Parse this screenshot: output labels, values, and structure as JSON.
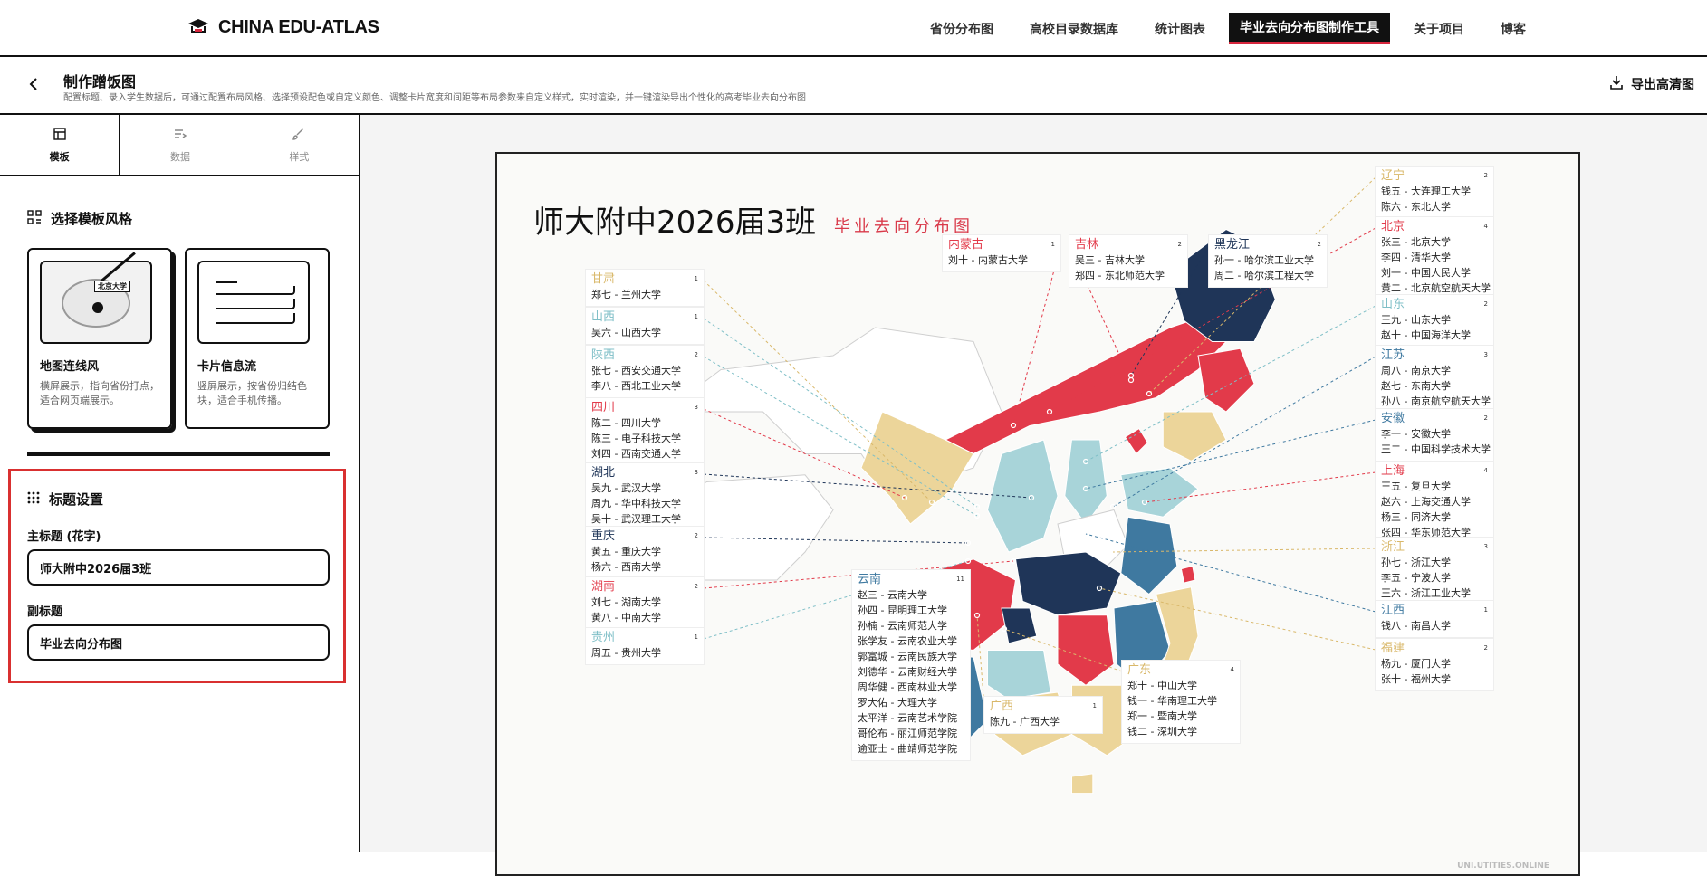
{
  "nav": {
    "logo_text": "CHINA EDU-ATLAS",
    "links": [
      "省份分布图",
      "高校目录数据库",
      "统计图表",
      "毕业去向分布图制作工具",
      "关于项目",
      "博客"
    ]
  },
  "header": {
    "title": "制作蹭饭图",
    "description": "配置标题、录入学生数据后，可通过配置布局风格、选择预设配色或自定义颜色、调整卡片宽度和间距等布局参数来自定义样式，实时渲染，并一键渲染导出个性化的高考毕业去向分布图",
    "export_label": "导出高清图"
  },
  "tabs": [
    {
      "label": "模板",
      "icon": "layout-icon"
    },
    {
      "label": "数据",
      "icon": "list-icon"
    },
    {
      "label": "样式",
      "icon": "brush-icon"
    }
  ],
  "template_section": {
    "title": "选择模板风格",
    "cards": [
      {
        "name": "地图连线风",
        "desc": "横屏展示，指向省份打点，适合网页端展示。",
        "thumb_label": "北京大学"
      },
      {
        "name": "卡片信息流",
        "desc": "竖屏展示，按省份归结色块，适合手机传播。"
      }
    ]
  },
  "title_section": {
    "title": "标题设置",
    "main_label": "主标题 (花字)",
    "main_value": "师大附中2026届3班",
    "sub_label": "副标题",
    "sub_value": "毕业去向分布图"
  },
  "poster": {
    "title": "师大附中2026届3班",
    "subtitle": "毕业去向分布图",
    "watermark": "UNI.UTITIES.ONLINE",
    "colors": {
      "red": "#e23a4a",
      "navy": "#1f3558",
      "steel": "#3f79a0",
      "teal": "#a8d4d9",
      "sand": "#ecd59a",
      "empty": "#ffffff"
    },
    "provinces": [
      {
        "name": "甘肃",
        "color": "#d9b86a",
        "count": "1",
        "entries": [
          "郑七 - 兰州大学"
        ]
      },
      {
        "name": "山西",
        "color": "#7fbfc7",
        "count": "1",
        "entries": [
          "吴六 - 山西大学"
        ]
      },
      {
        "name": "陕西",
        "color": "#7fbfc7",
        "count": "2",
        "entries": [
          "张七 - 西安交通大学",
          "李八 - 西北工业大学"
        ]
      },
      {
        "name": "四川",
        "color": "#e23a4a",
        "count": "3",
        "entries": [
          "陈二 - 四川大学",
          "陈三 - 电子科技大学",
          "刘四 - 西南交通大学"
        ]
      },
      {
        "name": "湖北",
        "color": "#1f3558",
        "count": "3",
        "entries": [
          "吴九 - 武汉大学",
          "周九 - 华中科技大学",
          "吴十 - 武汉理工大学"
        ]
      },
      {
        "name": "重庆",
        "color": "#1f3558",
        "count": "2",
        "entries": [
          "黄五 - 重庆大学",
          "杨六 - 西南大学"
        ]
      },
      {
        "name": "湖南",
        "color": "#e23a4a",
        "count": "2",
        "entries": [
          "刘七 - 湖南大学",
          "黄八 - 中南大学"
        ]
      },
      {
        "name": "贵州",
        "color": "#7fbfc7",
        "count": "1",
        "entries": [
          "周五 - 贵州大学"
        ]
      },
      {
        "name": "云南",
        "color": "#3f79a0",
        "count": "11",
        "entries": [
          "赵三 - 云南大学",
          "孙四 - 昆明理工大学",
          "孙楠 - 云南师范大学",
          "张学友 - 云南农业大学",
          "郭富城 - 云南民族大学",
          "刘德华 - 云南财经大学",
          "周华健 - 西南林业大学",
          "罗大佑 - 大理大学",
          "太平洋 - 云南艺术学院",
          "哥伦布 - 丽江师范学院",
          "逾亚士 - 曲靖师范学院"
        ]
      },
      {
        "name": "广西",
        "color": "#d9b86a",
        "count": "1",
        "entries": [
          "陈九 - 广西大学"
        ]
      },
      {
        "name": "广东",
        "color": "#d9b86a",
        "count": "4",
        "entries": [
          "郑十 - 中山大学",
          "钱一 - 华南理工大学",
          "郑一 - 暨南大学",
          "钱二 - 深圳大学"
        ]
      },
      {
        "name": "内蒙古",
        "color": "#e23a4a",
        "count": "1",
        "entries": [
          "刘十 - 内蒙古大学"
        ]
      },
      {
        "name": "吉林",
        "color": "#e23a4a",
        "count": "2",
        "entries": [
          "吴三 - 吉林大学",
          "郑四 - 东北师范大学"
        ]
      },
      {
        "name": "黑龙江",
        "color": "#1f3558",
        "count": "2",
        "entries": [
          "孙一 - 哈尔滨工业大学",
          "周二 - 哈尔滨工程大学"
        ]
      },
      {
        "name": "辽宁",
        "color": "#d9b86a",
        "count": "2",
        "entries": [
          "钱五 - 大连理工大学",
          "陈六 - 东北大学"
        ]
      },
      {
        "name": "北京",
        "color": "#e23a4a",
        "count": "4",
        "entries": [
          "张三 - 北京大学",
          "李四 - 清华大学",
          "刘一 - 中国人民大学",
          "黄二 - 北京航空航天大学"
        ]
      },
      {
        "name": "山东",
        "color": "#7fbfc7",
        "count": "2",
        "entries": [
          "王九 - 山东大学",
          "赵十 - 中国海洋大学"
        ]
      },
      {
        "name": "江苏",
        "color": "#3f79a0",
        "count": "3",
        "entries": [
          "周八 - 南京大学",
          "赵七 - 东南大学",
          "孙八 - 南京航空航天大学"
        ]
      },
      {
        "name": "安徽",
        "color": "#3f79a0",
        "count": "2",
        "entries": [
          "李一 - 安徽大学",
          "王二 - 中国科学技术大学"
        ]
      },
      {
        "name": "上海",
        "color": "#e23a4a",
        "count": "4",
        "entries": [
          "王五 - 复旦大学",
          "赵六 - 上海交通大学",
          "杨三 - 同济大学",
          "张四 - 华东师范大学"
        ]
      },
      {
        "name": "浙江",
        "color": "#d9b86a",
        "count": "3",
        "entries": [
          "孙七 - 浙江大学",
          "李五 - 宁波大学",
          "王六 - 浙江工业大学"
        ]
      },
      {
        "name": "江西",
        "color": "#3f79a0",
        "count": "1",
        "entries": [
          "钱八 - 南昌大学"
        ]
      },
      {
        "name": "福建",
        "color": "#d9b86a",
        "count": "2",
        "entries": [
          "杨九 - 厦门大学",
          "张十 - 福州大学"
        ]
      }
    ]
  }
}
